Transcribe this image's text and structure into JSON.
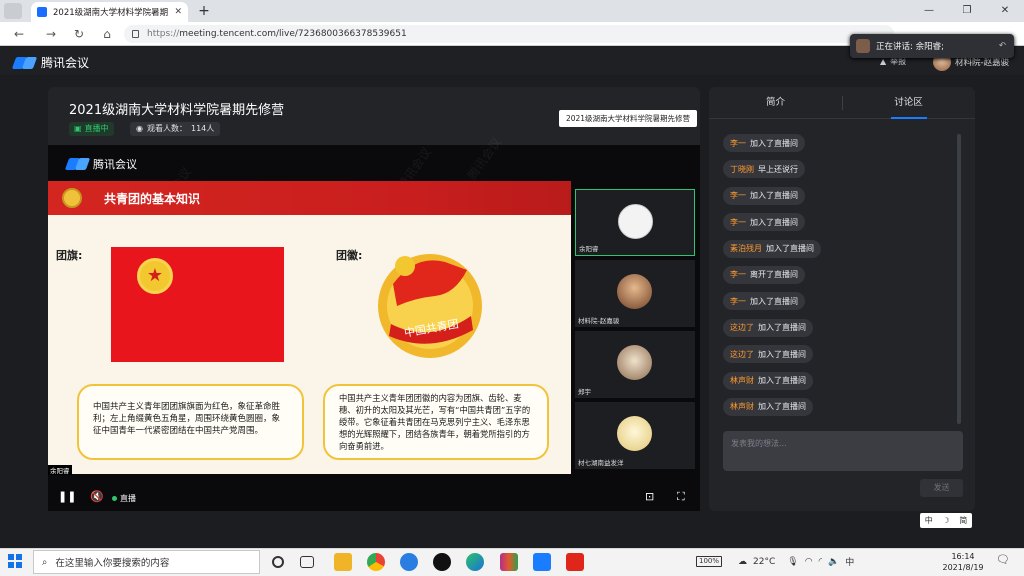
{
  "browser": {
    "tab_title": "2021级湖南大学材料学院暑期先...",
    "url_https": "https://",
    "url_rest": "meeting.tencent.com/live/7236800366378539651"
  },
  "app": {
    "logo_text": "腾讯会议",
    "report": "举报",
    "user_name": "材料院-赵嘉骏",
    "speaking_prefix": "正在讲话: 余阳睿;",
    "meeting_title": "2021级湖南大学材料学院暑期先修营",
    "live_label": "直播中",
    "viewers_label": "观看人数：",
    "viewers_count": "114人",
    "tooltip": "2021级湖南大学材料学院暑期先修营"
  },
  "slide": {
    "logo_text": "腾讯会议",
    "header": "共青团的基本知识",
    "flag_label": "团旗:",
    "emblem_label": "团徽:",
    "emblem_ribbon": "中国共青团",
    "flag_text": "中国共产主义青年团团旗旗面为红色，象征革命胜利；左上角缀黄色五角星，周围环绕黄色圆圈，象征中国青年一代紧密团结在中国共产党周围。",
    "emblem_text": "中国共产主义青年团团徽的内容为团旗、齿轮、麦穗、初升的太阳及其光芒，写有“中国共青团”五字的绶带。它象征着共青团在马克思列宁主义、毛泽东思想的光辉照耀下，团结各族青年，朝着党所指引的方向奋勇前进。",
    "presenter": "余阳睿",
    "watermark": "腾讯会议"
  },
  "thumbnails": [
    {
      "name": "余阳睿"
    },
    {
      "name": "材料院-赵嘉骏"
    },
    {
      "name": "郑宇"
    },
    {
      "name": "材七湖南益发洋"
    }
  ],
  "controls": {
    "live": "直播"
  },
  "panel": {
    "tab_intro": "简介",
    "tab_discuss": "讨论区",
    "messages": [
      {
        "name": "李一",
        "text": "加入了直播间"
      },
      {
        "name": "丁晓刚",
        "text": "早上还说行"
      },
      {
        "name": "李一",
        "text": "加入了直播间"
      },
      {
        "name": "李一",
        "text": "加入了直播间"
      },
      {
        "name": "素泊残月",
        "text": "加入了直播间"
      },
      {
        "name": "李一",
        "text": "离开了直播间"
      },
      {
        "name": "李一",
        "text": "加入了直播间"
      },
      {
        "name": "这边了",
        "text": "加入了直播间"
      },
      {
        "name": "这边了",
        "text": "加入了直播间"
      },
      {
        "name": "林声财",
        "text": "加入了直播间"
      },
      {
        "name": "林声财",
        "text": "加入了直播间"
      }
    ],
    "input_placeholder": "发表我的想法...",
    "send": "发送"
  },
  "ime": {
    "a": "中",
    "b": "☽",
    "c": "简"
  },
  "taskbar": {
    "search_placeholder": "在这里输入你要搜索的内容",
    "battery": "100%",
    "weather": "22°C",
    "lang": "中",
    "time": "16:14",
    "date": "2021/8/19"
  },
  "colors": {
    "accent": "#1a7cff",
    "live": "#2fc66e",
    "banner": "#d42620",
    "name": "#ff9a2e"
  }
}
